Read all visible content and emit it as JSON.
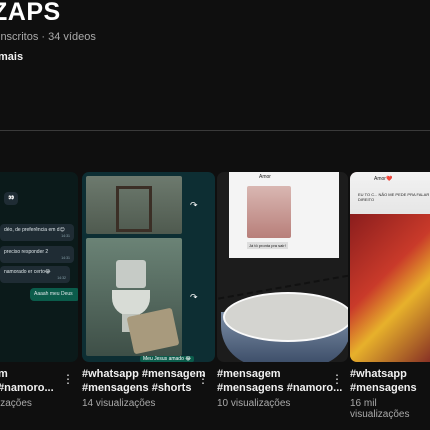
{
  "channel": {
    "name": "ZAPS",
    "meta": "inscritos · 34 vídeos",
    "more": "mais"
  },
  "videos": [
    {
      "title": [
        "m",
        "#namoro..."
      ],
      "views": "izações",
      "chat": [
        "👀",
        "déo, de preferência em d😊",
        "preciso responder 2",
        "namorado er certo😂",
        "Aaaah meu Deus"
      ]
    },
    {
      "title": [
        "#whatsapp #mensagem",
        "#mensagens #shorts"
      ],
      "views": "14 visualizações",
      "caption": "Meu Jesus amado 😂"
    },
    {
      "title": [
        "#mensagem",
        "#mensagens #namoro..."
      ],
      "views": "10 visualizações",
      "chat": [
        "Amor",
        "Já tô pronta pra sair!"
      ]
    },
    {
      "title": [
        "#whatsapp",
        "#mensagens"
      ],
      "views": "16 mil visualizações",
      "chat": [
        "Amor❤️",
        "EU TO C... NÃO ME PEDE PRA FALAR DIREITO"
      ]
    }
  ],
  "icons": [
    "more-vert-icon",
    "share-icon"
  ],
  "colors": {
    "background": "#0f0f0f",
    "text": "#f1f1f1",
    "secondary": "#aaaaaa"
  }
}
